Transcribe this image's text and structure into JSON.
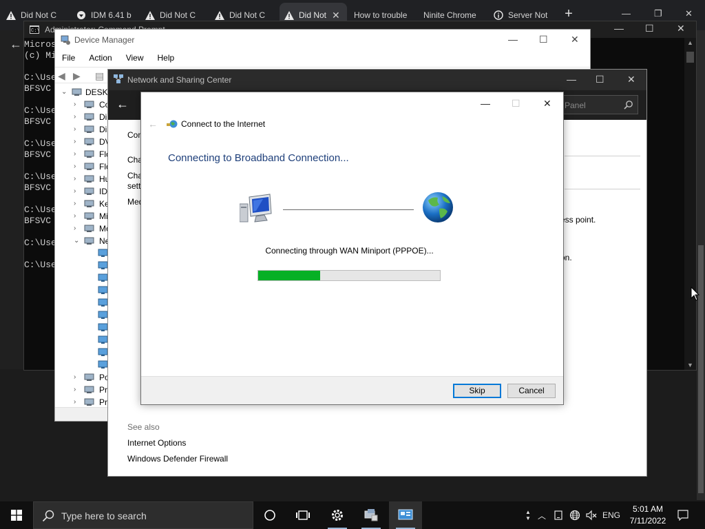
{
  "browser": {
    "tabs": [
      {
        "title": "Did Not C",
        "icon": "warning-icon",
        "active": false
      },
      {
        "title": "IDM 6.41 b",
        "icon": "idm-icon",
        "active": false
      },
      {
        "title": "Did Not C",
        "icon": "warning-icon",
        "active": false
      },
      {
        "title": "Did Not C",
        "icon": "warning-icon",
        "active": false
      },
      {
        "title": "Did Not",
        "icon": "warning-icon",
        "active": true
      },
      {
        "title": "How to trouble",
        "icon": "page-icon",
        "active": false
      },
      {
        "title": "Ninite Chrome",
        "icon": "page-icon",
        "active": false
      },
      {
        "title": "Server Not",
        "icon": "info-icon",
        "active": false
      }
    ],
    "new_tab_label": "+"
  },
  "cmd": {
    "title": "Administrator: Command Prompt",
    "lines": [
      "Micros",
      "(c) Mi",
      "",
      "C:\\Use",
      "BFSVC",
      "",
      "C:\\Use",
      "BFSVC",
      "",
      "C:\\Use",
      "BFSVC",
      "",
      "C:\\Use",
      "BFSVC",
      "",
      "C:\\Use",
      "BFSVC",
      "",
      "C:\\Use",
      "",
      "C:\\Use"
    ]
  },
  "device_manager": {
    "title": "Device Manager",
    "menu": [
      "File",
      "Action",
      "View",
      "Help"
    ],
    "tree": [
      {
        "label": "DESKT",
        "chev": "down",
        "level": 0
      },
      {
        "label": "Co",
        "chev": "right",
        "level": 1
      },
      {
        "label": "Di",
        "chev": "right",
        "level": 1
      },
      {
        "label": "Dis",
        "chev": "right",
        "level": 1
      },
      {
        "label": "DV",
        "chev": "right",
        "level": 1
      },
      {
        "label": "Flo",
        "chev": "right",
        "level": 1
      },
      {
        "label": "Flo",
        "chev": "right",
        "level": 1
      },
      {
        "label": "Hu",
        "chev": "right",
        "level": 1
      },
      {
        "label": "IDI",
        "chev": "right",
        "level": 1
      },
      {
        "label": "Ke",
        "chev": "right",
        "level": 1
      },
      {
        "label": "Mi",
        "chev": "right",
        "level": 1
      },
      {
        "label": "Mo",
        "chev": "right",
        "level": 1
      },
      {
        "label": "Ne",
        "chev": "down",
        "level": 1
      },
      {
        "label": "",
        "chev": "",
        "level": 2
      },
      {
        "label": "",
        "chev": "",
        "level": 2
      },
      {
        "label": "",
        "chev": "",
        "level": 2
      },
      {
        "label": "",
        "chev": "",
        "level": 2
      },
      {
        "label": "",
        "chev": "",
        "level": 2
      },
      {
        "label": "",
        "chev": "",
        "level": 2
      },
      {
        "label": "",
        "chev": "",
        "level": 2
      },
      {
        "label": "",
        "chev": "",
        "level": 2
      },
      {
        "label": "",
        "chev": "",
        "level": 2
      },
      {
        "label": "",
        "chev": "",
        "level": 2
      },
      {
        "label": "Po",
        "chev": "right",
        "level": 1
      },
      {
        "label": "Pri",
        "chev": "right",
        "level": 1
      },
      {
        "label": "Pr",
        "chev": "right",
        "level": 1
      }
    ]
  },
  "nsc": {
    "title": "Network and Sharing Center",
    "search_placeholder": "Panel",
    "left_links": [
      "Con",
      "Cha",
      "Cha",
      "sett",
      "Med"
    ],
    "right_text": [
      "ess point.",
      "on."
    ],
    "see_also": "See also",
    "links": [
      "Internet Options",
      "Windows Defender Firewall"
    ]
  },
  "dialog": {
    "heading": "Connect to the Internet",
    "status": "Connecting to Broadband Connection...",
    "through": "Connecting through WAN Miniport (PPPOE)...",
    "progress": 0.34,
    "skip_label": "Skip",
    "cancel_label": "Cancel"
  },
  "taskbar": {
    "search_placeholder": "Type here to search",
    "language": "ENG",
    "time": "5:01 AM",
    "date": "7/11/2022"
  },
  "colors": {
    "accent": "#0078d7",
    "progress_fill": "#06b025",
    "heading_blue": "#1e3f7a"
  }
}
